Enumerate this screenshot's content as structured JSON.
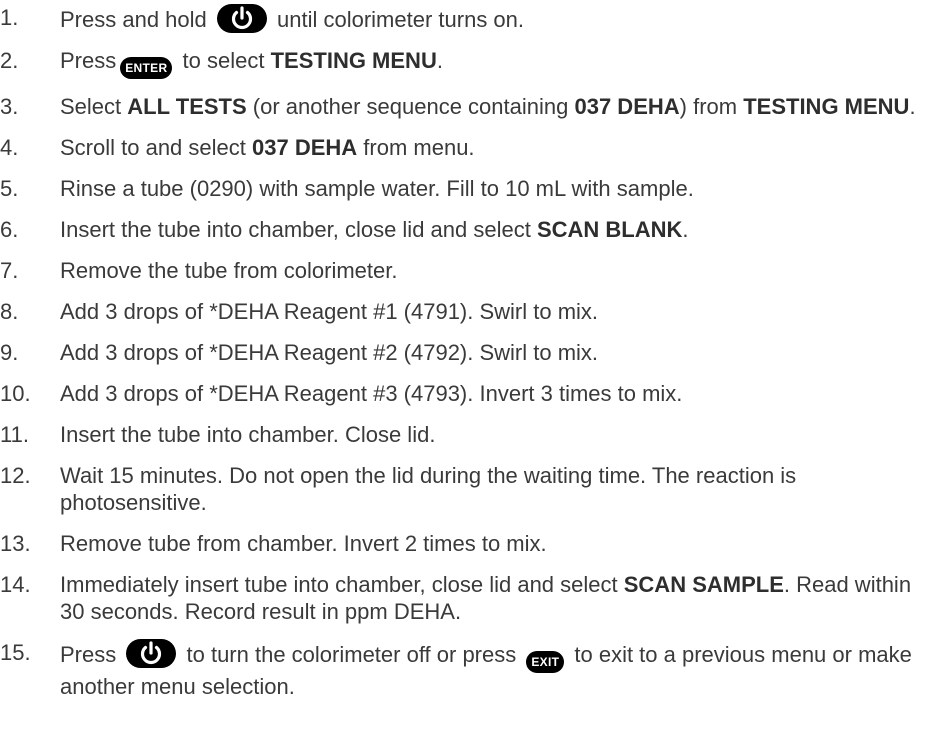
{
  "icons": {
    "power": "power-button-icon",
    "enter": "enter-button-icon",
    "exit": "exit-button-icon"
  },
  "steps": [
    {
      "num": "1.",
      "pre": "Press and hold",
      "post": "until colorimeter turns on."
    },
    {
      "num": "2.",
      "pre": "Press",
      "enter": "ENTER",
      "post": "to select",
      "bold": "TESTING MENU",
      "end": "."
    },
    {
      "num": "3.",
      "t1": "Select",
      "b1": "ALL TESTS",
      "t2": "(or another sequence containing",
      "b2": "037 DEHA",
      "t3": ") from",
      "b3": "TESTING MENU",
      "t4": "."
    },
    {
      "num": "4.",
      "t1": "Scroll to and select",
      "b1": "037 DEHA",
      "t2": "from menu."
    },
    {
      "num": "5.",
      "text": "Rinse a tube (0290) with sample water. Fill to 10 mL with sample."
    },
    {
      "num": "6.",
      "t1": "Insert the tube into chamber, close lid and select",
      "b1": "SCAN BLANK",
      "t2": "."
    },
    {
      "num": "7.",
      "text": "Remove the tube from colorimeter."
    },
    {
      "num": "8.",
      "text": "Add 3 drops of *DEHA Reagent #1 (4791). Swirl to mix."
    },
    {
      "num": "9.",
      "text": "Add 3 drops of *DEHA Reagent #2 (4792). Swirl to mix."
    },
    {
      "num": "10.",
      "text": "Add 3 drops of *DEHA Reagent #3 (4793). Invert 3 times to mix."
    },
    {
      "num": "11.",
      "text": "Insert the tube into chamber. Close lid."
    },
    {
      "num": "12.",
      "text": "Wait 15 minutes. Do not open the lid during the waiting time. The reaction is photosensitive."
    },
    {
      "num": "13.",
      "text": "Remove tube from chamber. Invert 2 times to mix."
    },
    {
      "num": "14.",
      "t1": "Immediately insert tube into chamber, close lid and select",
      "b1": "SCAN SAMPLE",
      "t2": ". Read within 30 seconds. Record result in ppm DEHA."
    },
    {
      "num": "15.",
      "pre": "Press",
      "mid": "to turn the colorimeter off or press",
      "exit": "EXIT",
      "post": "to exit to a previous menu or make another menu selection."
    }
  ]
}
